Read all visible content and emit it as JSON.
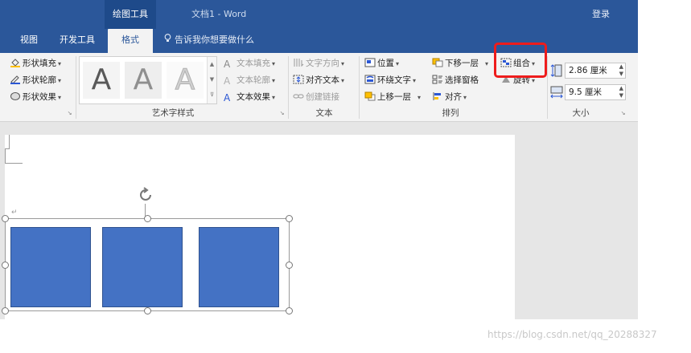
{
  "titlebar": {
    "context_tab": "绘图工具",
    "document_title": "文档1  -  Word",
    "login": "登录"
  },
  "tabs": {
    "view": "视图",
    "developer": "开发工具",
    "format": "格式",
    "tell_me": "告诉我你想要做什么"
  },
  "ribbon": {
    "shape_styles": {
      "fill": "形状填充",
      "outline": "形状轮廓",
      "effects": "形状效果"
    },
    "wordart": {
      "label": "艺术字样式",
      "samples": [
        "A",
        "A",
        "A"
      ],
      "text_fill": "文本填充",
      "text_outline": "文本轮廓",
      "text_effects": "文本效果"
    },
    "text": {
      "label": "文本",
      "direction": "文字方向",
      "align": "对齐文本",
      "link": "创建链接"
    },
    "arrange": {
      "label": "排列",
      "position": "位置",
      "wrap": "环绕文字",
      "forward": "上移一层",
      "backward": "下移一层",
      "selection_pane": "选择窗格",
      "align": "对齐",
      "group": "组合",
      "rotate": "旋转"
    },
    "size": {
      "label": "大小",
      "height": "2.86 厘米",
      "width": "9.5 厘米"
    }
  },
  "document": {
    "para_mark": "↵"
  },
  "watermark": "https://blog.csdn.net/qq_20288327",
  "colors": {
    "ribbon_blue": "#2b579a",
    "shape_fill": "#4472c4",
    "highlight": "#ee1c1c"
  }
}
